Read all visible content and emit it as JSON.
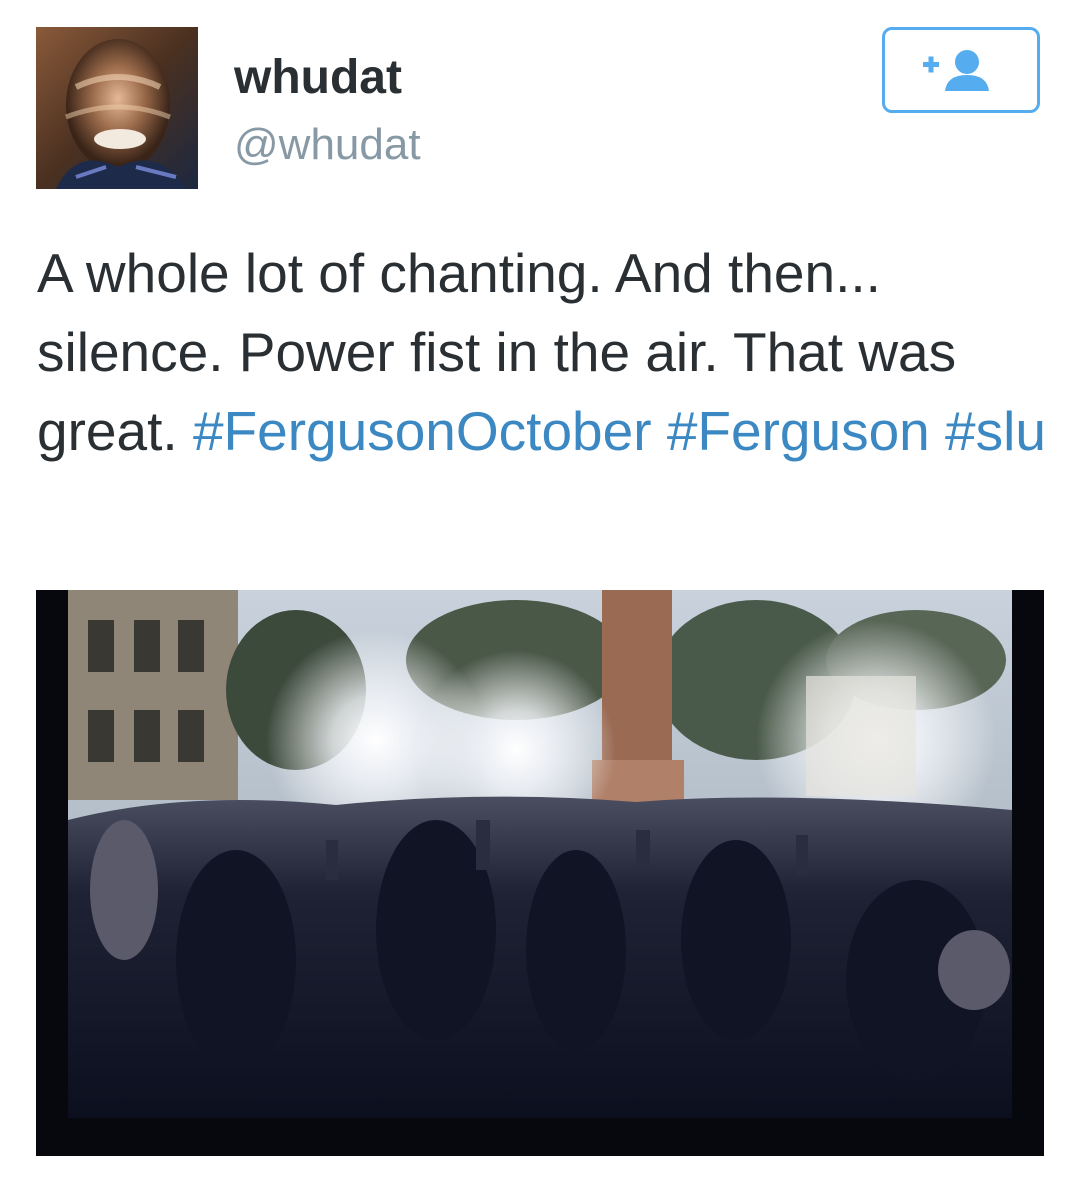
{
  "author": {
    "display_name": "whudat",
    "handle": "@whudat"
  },
  "follow_button": {
    "icon": "follow-user-plus-icon",
    "color": "#55acee"
  },
  "tweet": {
    "text_parts": [
      "A whole lot of chanting. And then... silence. Power fist in the air. That was great. ",
      "#FergusonOctober",
      " ",
      "#Ferguson",
      " ",
      "#slu"
    ],
    "hashtag_color": "#3b88c3"
  },
  "media": {
    "description_icon": "photo-icon"
  }
}
